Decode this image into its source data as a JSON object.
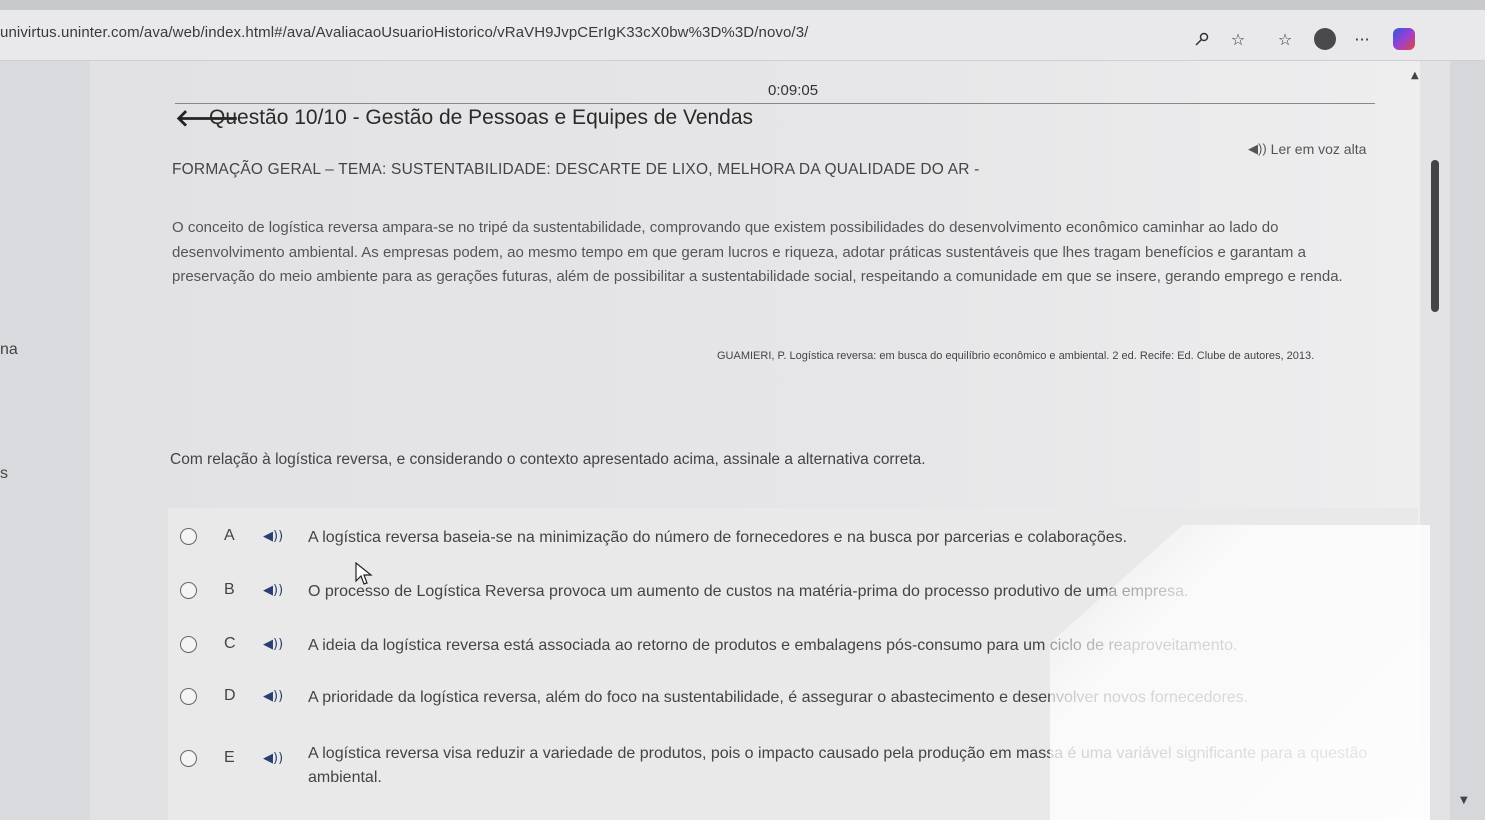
{
  "browser": {
    "url": "univirtus.uninter.com/ava/web/index.html#/ava/AvaliacaoUsuarioHistorico/vRaVH9JvpCErIgK33cX0bw%3D%3D/novo/3/",
    "icons": [
      "key-icon",
      "star-icon",
      "favorites-icon",
      "profile-icon",
      "more-icon",
      "copilot-icon"
    ]
  },
  "sidebar_fragments": [
    "na",
    "s"
  ],
  "quiz": {
    "timer": "0:09:05",
    "title": "Questão 10/10 - Gestão de Pessoas e Equipes de Vendas",
    "read_aloud": "Ler em voz alta",
    "heading": "FORMAÇÃO GERAL – TEMA: SUSTENTABILIDADE: DESCARTE DE LIXO, MELHORA DA QUALIDADE DO AR -",
    "paragraph": "O conceito de logística reversa ampara-se no tripé da sustentabilidade, comprovando que existem possibilidades do desenvolvimento econômico caminhar ao lado do desenvolvimento ambiental. As empresas podem, ao mesmo tempo em que geram lucros e riqueza, adotar práticas sustentáveis que lhes tragam benefícios e garantam a preservação do meio ambiente para as gerações futuras, além de possibilitar a sustentabilidade social, respeitando a comunidade em que se insere, gerando emprego e renda.",
    "citation": "GUAMIERI, P. Logística reversa: em busca do equilíbrio econômico e ambiental. 2 ed. Recife: Ed. Clube de autores, 2013.",
    "question": "Com relação à logística reversa, e considerando o contexto apresentado acima, assinale a alternativa correta.",
    "options": [
      {
        "letter": "A",
        "text": "A logística reversa baseia-se na minimização do número de fornecedores e na busca por parcerias e colaborações."
      },
      {
        "letter": "B",
        "text": "O processo de Logística Reversa provoca um aumento de custos na matéria-prima do processo produtivo de uma empresa."
      },
      {
        "letter": "C",
        "text": "A ideia da logística reversa está associada ao retorno de produtos e embalagens pós-consumo para um ciclo de reaproveitamento."
      },
      {
        "letter": "D",
        "text": "A prioridade da logística reversa, além do foco na sustentabilidade, é assegurar o abastecimento e desenvolver novos fornecedores."
      },
      {
        "letter": "E",
        "text": "A logística reversa visa reduzir a variedade de produtos, pois o impacto causado pela produção em massa é uma variável significante para a questão ambiental."
      }
    ]
  }
}
